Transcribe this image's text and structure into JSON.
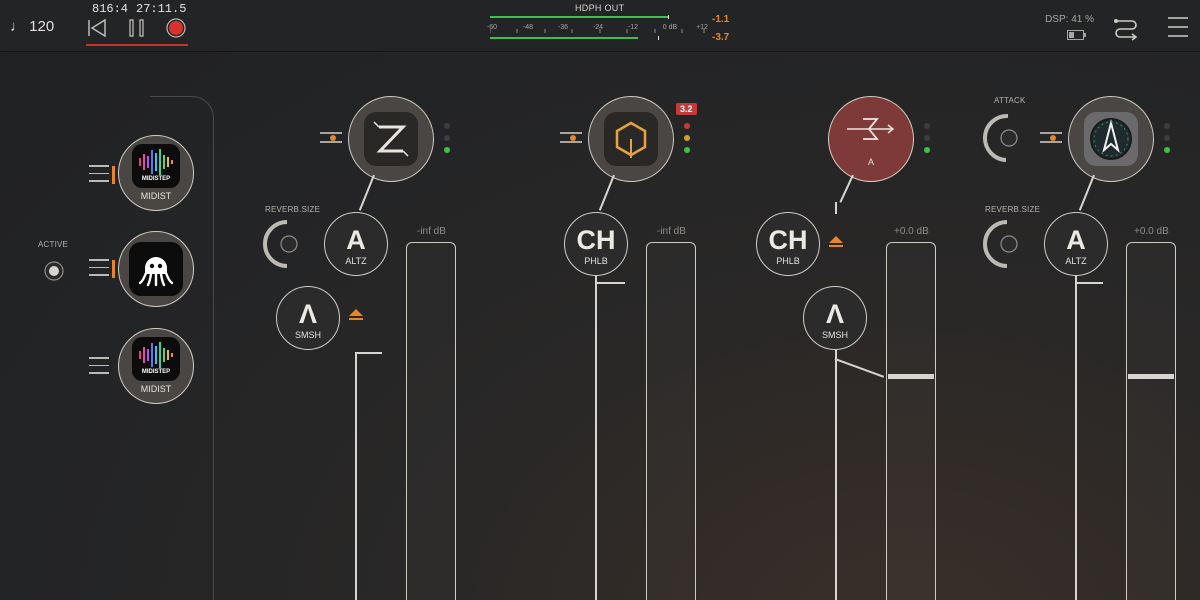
{
  "transport": {
    "tempo": "♩ 120",
    "bars_beats": "816:4",
    "time": "27:11.5"
  },
  "meter": {
    "label": "HDPH OUT",
    "ticks": [
      "-60",
      "-48",
      "-36",
      "-24",
      "-12",
      "0 dB",
      "+12"
    ],
    "peak_top": "-1.1",
    "peak_bottom": "-3.7"
  },
  "status": {
    "dsp": "DSP: 41 %"
  },
  "sidebar": {
    "active_label": "ACTIVE",
    "sources": [
      {
        "app_label": "MIDISTEP",
        "name": "MIDIST"
      },
      {
        "app_label": "",
        "name": ""
      },
      {
        "app_label": "MIDISTEP",
        "name": "MIDIST"
      }
    ]
  },
  "channels": [
    {
      "knob_label": "REVERB.SIZE",
      "plugins": [
        {
          "name": "ALTZ"
        },
        {
          "name": "SMSH"
        }
      ],
      "fader_label": "-inf dB"
    },
    {
      "badge": "3.2",
      "plugins": [
        {
          "name": "PHLB"
        }
      ],
      "fader_label": "-inf dB"
    },
    {
      "main_name": "A",
      "plugins": [
        {
          "name": "PHLB"
        },
        {
          "name": "SMSH"
        }
      ],
      "fader_label": "+0.0 dB"
    },
    {
      "top_knob_label": "ATTACK",
      "knob_label": "REVERB.SIZE",
      "plugins": [
        {
          "name": "ALTZ"
        }
      ],
      "fader_label": "+0.0 dB"
    }
  ],
  "colors": {
    "accent": "#e6862a",
    "record": "#d8322c",
    "led_green": "#3cc24a",
    "background": "#232426"
  }
}
